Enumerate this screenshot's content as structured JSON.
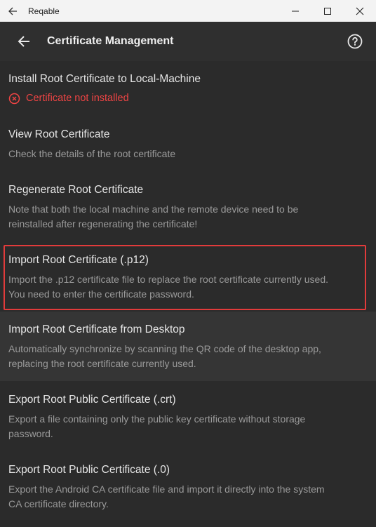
{
  "window": {
    "app_title": "Reqable",
    "icons": {
      "back": "back-arrow-icon",
      "minimize": "minimize-icon",
      "maximize": "maximize-icon",
      "close": "close-icon"
    }
  },
  "appbar": {
    "title": "Certificate Management",
    "icons": {
      "back": "arrow-left-icon",
      "help": "help-circle-icon"
    }
  },
  "items": [
    {
      "title": "Install Root Certificate to Local-Machine",
      "status": "Certificate not installed",
      "status_icon": "error-circle-icon",
      "status_color": "#ef4444"
    },
    {
      "title": "View Root Certificate",
      "subtitle": "Check the details of the root certificate"
    },
    {
      "title": "Regenerate Root Certificate",
      "subtitle_lines": [
        "Note that both the local machine and the remote device need to be",
        "reinstalled after regenerating the certificate!"
      ]
    },
    {
      "title": "Import Root Certificate (.p12)",
      "subtitle_lines": [
        "Import the .p12 certificate file to replace the root certificate currently used.",
        "You need to enter the certificate password."
      ]
    },
    {
      "title": "Import Root Certificate from Desktop",
      "subtitle_lines": [
        "Automatically synchronize by scanning the QR code of the desktop app,",
        "replacing the root certificate currently used."
      ]
    },
    {
      "title": "Export Root Public Certificate (.crt)",
      "subtitle_lines": [
        "Export a file containing only the public key certificate without storage",
        "password."
      ]
    },
    {
      "title": "Export Root Public Certificate (.0)",
      "subtitle_lines": [
        "Export the Android CA certificate file and import it directly into the system",
        "CA certificate directory."
      ]
    }
  ],
  "colors": {
    "highlight": "#e23b3b",
    "background": "#2b2b2b",
    "hover_row": "#353535",
    "error": "#ef4444"
  }
}
